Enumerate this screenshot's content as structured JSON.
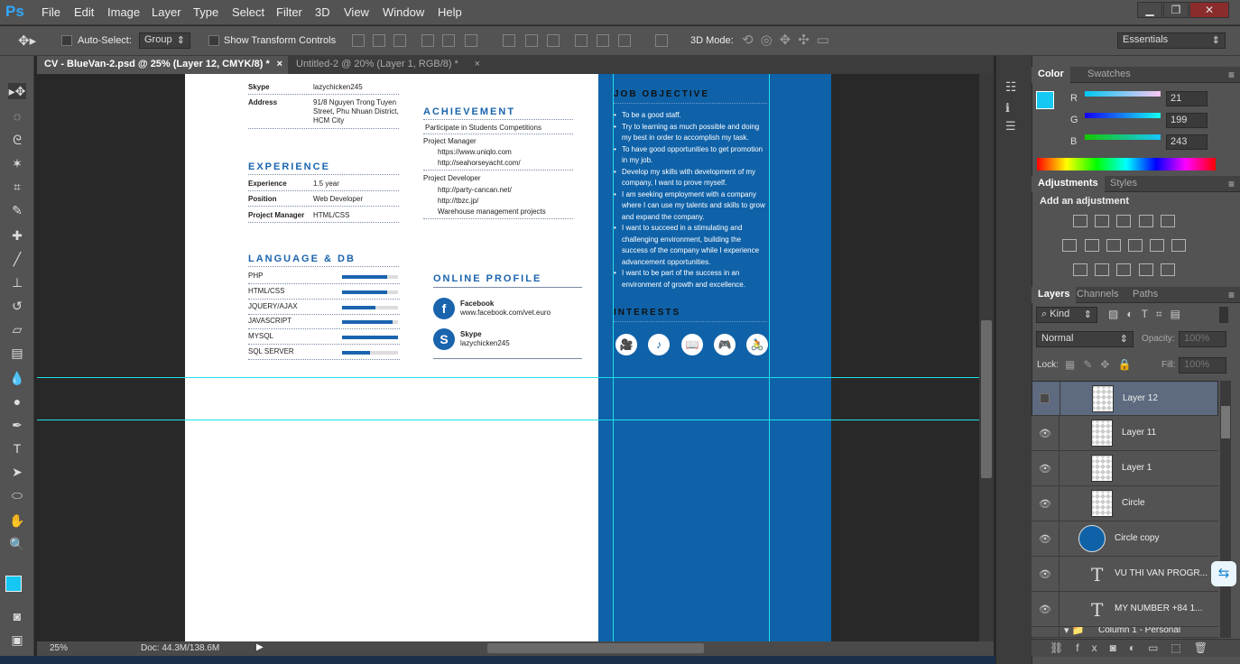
{
  "app": {
    "logo": "Ps"
  },
  "menu": [
    "File",
    "Edit",
    "Image",
    "Layer",
    "Type",
    "Select",
    "Filter",
    "3D",
    "View",
    "Window",
    "Help"
  ],
  "window_controls": {
    "minimize": "▁",
    "restore": "❐",
    "close": "✕"
  },
  "options": {
    "auto_select_label": "Auto-Select:",
    "auto_select_value": "Group",
    "show_transform": "Show Transform Controls",
    "mode_3d": "3D Mode:",
    "workspace": "Essentials"
  },
  "tabs": [
    {
      "label": "CV - BlueVan-2.psd @ 25% (Layer 12, CMYK/8) *",
      "close": "×"
    },
    {
      "label": "Untitled-2 @ 20% (Layer 1, RGB/8) *",
      "close": "×"
    }
  ],
  "cv": {
    "contact": [
      {
        "k": "Skype",
        "v": "lazychicken245"
      },
      {
        "k": "Address",
        "v": "91/8 Nguyen Trong Tuyen Street, Phu Nhuan District, HCM City"
      }
    ],
    "experience_title": "EXPERIENCE",
    "experience": [
      {
        "k": "Experience",
        "v": "1.5 year"
      },
      {
        "k": "Position",
        "v": "Web Developer"
      },
      {
        "k": "Project Manager",
        "v": "HTML/CSS"
      }
    ],
    "achievement_title": "ACHIEVEMENT",
    "achievement": [
      "Participate in Students Competitions",
      "Project Manager",
      "https://www.uniqlo.com",
      "http://seahorseyacht.com/",
      "Project Developer",
      "http://party-cancan.net/",
      "http://tbzc.jp/",
      "Warehouse management projects"
    ],
    "language_title": "LANGUAGE & DB",
    "skills": [
      {
        "name": "PHP",
        "level": 0.8
      },
      {
        "name": "HTML/CSS",
        "level": 0.8
      },
      {
        "name": "JQUERY/AJAX",
        "level": 0.6
      },
      {
        "name": "JAVASCRIPT",
        "level": 0.9
      },
      {
        "name": "MYSQL",
        "level": 1.0
      },
      {
        "name": "SQL SERVER",
        "level": 0.5
      }
    ],
    "online_title": "ONLINE PROFILE",
    "online": [
      {
        "icon": "f",
        "name": "Facebook",
        "value": "www.facebook.com/vet.euro"
      },
      {
        "icon": "S",
        "name": "Skype",
        "value": "lazychicken245"
      }
    ],
    "objective_title": "JOB OBJECTIVE",
    "objectives": [
      "To be a good staff.",
      "Try to learning as much possible and doing my best in order to accomplish my task.",
      "To have good opportunities to get promotion in my job.",
      "Develop my skills with development of my company, I want to prove myself.",
      "I am seeking employment with a company where I can use my talents and skills to grow and expand the company.",
      "I want to succeed in a stimulating and challenging environment, building the success of the company while I experience advancement opportunities.",
      "I want to be part of the success in an environment of growth and excellence."
    ],
    "interests_title": "INTERESTS",
    "interests": [
      "🎥",
      "♪",
      "📖",
      "🎮",
      "🚴"
    ]
  },
  "status": {
    "zoom": "25%",
    "doc": "Doc: 44.3M/138.6M"
  },
  "color_panel": {
    "tabs": [
      "Color",
      "Swatches"
    ],
    "r_label": "R",
    "g_label": "G",
    "b_label": "B",
    "r": "21",
    "g": "199",
    "b": "243",
    "fg": "#15c7f3"
  },
  "adjustments": {
    "tabs": [
      "Adjustments",
      "Styles"
    ],
    "title": "Add an adjustment"
  },
  "layers_panel": {
    "tabs": [
      "Layers",
      "Channels",
      "Paths"
    ],
    "kind": "Kind",
    "blend": "Normal",
    "opacity_label": "Opacity:",
    "opacity": "100%",
    "lock_label": "Lock:",
    "fill_label": "Fill:",
    "fill": "100%",
    "layers": [
      {
        "name": "Layer 12",
        "type": "pixel",
        "visible": false,
        "selected": true
      },
      {
        "name": "Layer 11",
        "type": "pixel",
        "visible": true,
        "selected": false
      },
      {
        "name": "Layer 1",
        "type": "pixel",
        "visible": true,
        "selected": false
      },
      {
        "name": "Circle",
        "type": "pixel",
        "visible": true,
        "selected": false
      },
      {
        "name": "Circle copy",
        "type": "shape",
        "visible": true,
        "selected": false
      },
      {
        "name": "VU THI VAN PROGR...",
        "type": "text",
        "visible": true,
        "selected": false
      },
      {
        "name": "MY NUMBER  +84 1...",
        "type": "text",
        "visible": true,
        "selected": false
      },
      {
        "name": "Column 1 - Personal",
        "type": "group",
        "visible": true,
        "selected": false
      }
    ]
  }
}
